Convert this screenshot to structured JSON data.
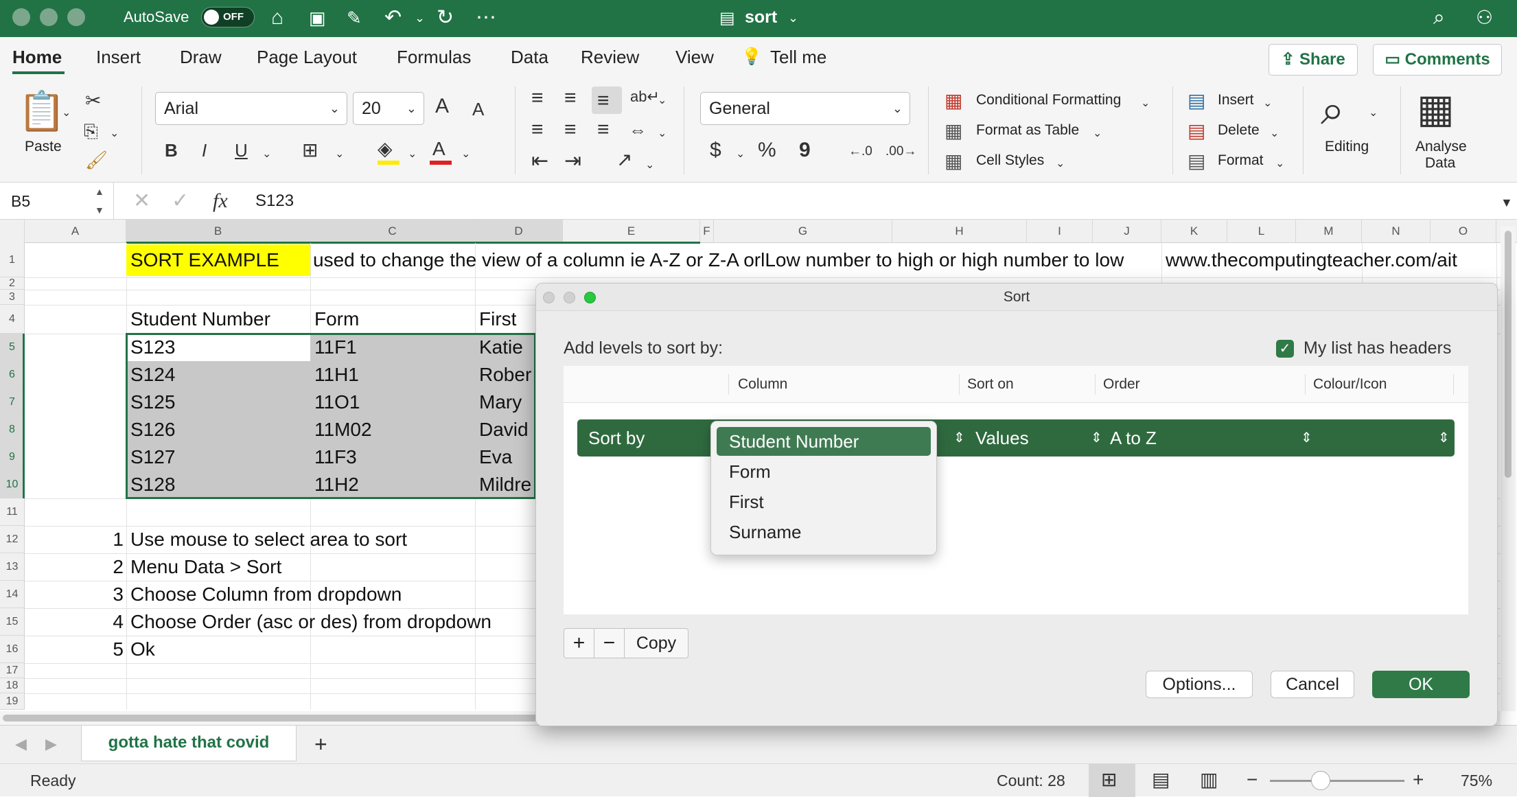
{
  "window": {
    "title": "sort",
    "autosave_label": "AutoSave",
    "autosave_state": "OFF"
  },
  "ribbon_tabs": [
    "Home",
    "Insert",
    "Draw",
    "Page Layout",
    "Formulas",
    "Data",
    "Review",
    "View",
    "Tell me"
  ],
  "actions": {
    "share": "Share",
    "comments": "Comments"
  },
  "ribbon": {
    "paste": "Paste",
    "font_name": "Arial",
    "font_size": "20",
    "number_format": "General",
    "conditional_formatting": "Conditional Formatting",
    "format_as_table": "Format as Table",
    "cell_styles": "Cell Styles",
    "insert": "Insert",
    "delete": "Delete",
    "format": "Format",
    "editing": "Editing",
    "analyse_data_1": "Analyse",
    "analyse_data_2": "Data",
    "bold": "B",
    "italic": "I",
    "underline": "U",
    "increase_font": "A",
    "decrease_font": "A",
    "font_color": "A",
    "currency": "$",
    "percent": "%",
    "comma": "9"
  },
  "formula_bar": {
    "name_box": "B5",
    "fx": "fx",
    "formula": "S123"
  },
  "columns": [
    "A",
    "B",
    "C",
    "D",
    "E",
    "F",
    "G",
    "H",
    "I",
    "J",
    "K",
    "L",
    "M",
    "N",
    "O"
  ],
  "rows": [
    "1",
    "2",
    "3",
    "4",
    "5",
    "6",
    "7",
    "8",
    "9",
    "10",
    "11",
    "12",
    "13",
    "14",
    "15",
    "16",
    "17",
    "18",
    "19"
  ],
  "sheet": {
    "b1": "SORT EXAMPLE",
    "c1": "used to change the view of a column ie A-Z or Z-A orlLow number to high or high number to low",
    "k1": "www.thecomputingteacher.com/ait",
    "headers": [
      "Student Number",
      "Form",
      "First"
    ],
    "data": [
      [
        "S123",
        "11F1",
        "Katie"
      ],
      [
        "S124",
        "11H1",
        "Rober"
      ],
      [
        "S125",
        "11O1",
        "Mary"
      ],
      [
        "S126",
        "11M02",
        "David"
      ],
      [
        "S127",
        "11F3",
        "Eva"
      ],
      [
        "S128",
        "11H2",
        "Mildre"
      ]
    ],
    "steps": [
      {
        "n": "1",
        "text": "Use mouse to select area to sort"
      },
      {
        "n": "2",
        "text": "Menu Data > Sort"
      },
      {
        "n": "3",
        "text": "Choose Column from dropdown"
      },
      {
        "n": "4",
        "text": "Choose Order (asc or des) from dropdown"
      },
      {
        "n": "5",
        "text": "Ok"
      }
    ]
  },
  "sheet_tab": "gotta hate that covid",
  "status": {
    "ready": "Ready",
    "count": "Count: 28",
    "zoom": "75%"
  },
  "dialog": {
    "title": "Sort",
    "add_levels": "Add levels to sort by:",
    "headers_checkbox": "My list has headers",
    "headers_checked": true,
    "col_headers": [
      "Column",
      "Sort on",
      "Order",
      "Colour/Icon"
    ],
    "sort_by": "Sort by",
    "sort_on": "Values",
    "order": "A to Z",
    "dropdown_options": [
      "Student Number",
      "Form",
      "First",
      "Surname"
    ],
    "dropdown_selected": "Student Number",
    "add": "+",
    "remove": "−",
    "copy": "Copy",
    "options": "Options...",
    "cancel": "Cancel",
    "ok": "OK"
  },
  "colors": {
    "brand": "#217346",
    "selection": "#c8c8c8",
    "highlight": "#ffff00"
  }
}
